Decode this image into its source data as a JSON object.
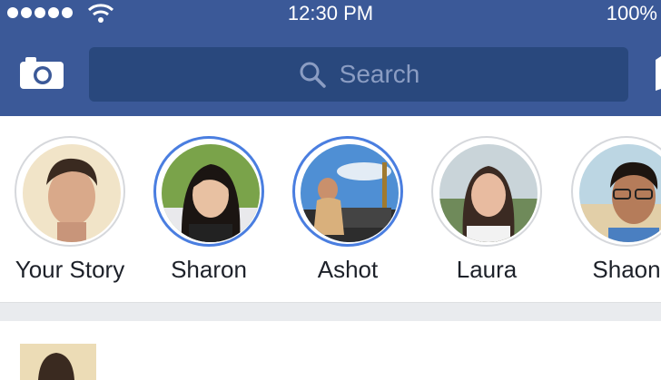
{
  "status_bar": {
    "time": "12:30 PM",
    "battery": "100%",
    "signal_icon": "signal-dots-icon",
    "wifi_icon": "wifi-icon"
  },
  "header": {
    "background_color": "#3b5998",
    "camera_icon": "camera-icon",
    "search_icon": "search-icon",
    "search_placeholder": "Search",
    "messenger_icon": "messenger-icon"
  },
  "stories": {
    "ring_color_new": "#4a7ee0",
    "ring_color_seen": "#d6d8dc",
    "items": [
      {
        "label": "Your Story",
        "state": "seen"
      },
      {
        "label": "Sharon",
        "state": "new"
      },
      {
        "label": "Ashot",
        "state": "new"
      },
      {
        "label": "Laura",
        "state": "seen"
      },
      {
        "label": "Shaon",
        "state": "seen"
      }
    ]
  }
}
